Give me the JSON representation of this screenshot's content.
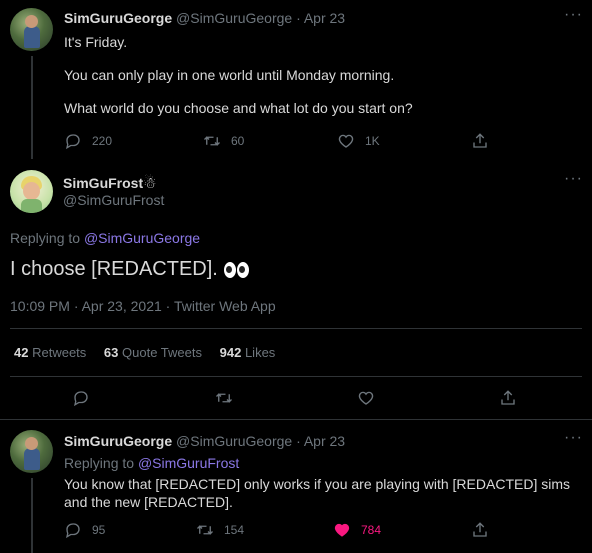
{
  "tweet1": {
    "display_name": "SimGuruGeorge",
    "handle_date": "@SimGuruGeorge · Apr 23",
    "lines": [
      "It's Friday.",
      "You can only play in one world until Monday morning.",
      "What world do you choose and what lot do you start on?"
    ],
    "replies": "220",
    "retweets": "60",
    "likes": "1K"
  },
  "main_tweet": {
    "display_name": "SimGuFrost",
    "name_emoji": "☃",
    "handle": "@SimGuruFrost",
    "replying_label": "Replying to",
    "replying_to": "@SimGuruGeorge",
    "text": "I choose [REDACTED].",
    "emoji": "👀",
    "timestamp": "10:09 PM · Apr 23, 2021 · Twitter Web App",
    "stats": {
      "retweets_count": "42",
      "retweets_label": "Retweets",
      "quotes_count": "63",
      "quotes_label": "Quote Tweets",
      "likes_count": "942",
      "likes_label": "Likes"
    }
  },
  "reply": {
    "display_name": "SimGuruGeorge",
    "handle_date": "@SimGuruGeorge · Apr 23",
    "replying_label": "Replying to",
    "replying_to": "@SimGuruFrost",
    "text": "You know that [REDACTED] only works if you are playing with [REDACTED] sims and the new [REDACTED].",
    "replies": "95",
    "retweets": "154",
    "likes": "784",
    "liked_color": "#f91880"
  },
  "icons": [
    "reply-icon",
    "retweet-icon",
    "like-icon",
    "share-icon",
    "more-icon"
  ]
}
